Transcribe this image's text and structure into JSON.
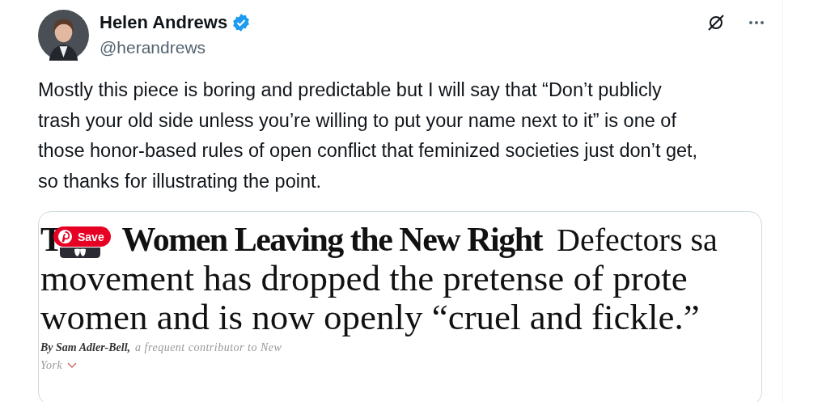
{
  "author": {
    "name": "Helen Andrews",
    "verified": true,
    "handle": "@herandrews"
  },
  "text": "Mostly this piece is boring and predictable but I will say that “Don’t publicly trash your old side unless you’re willing to put your name next to it” is one of those honor-based rules of open conflict that feminized societies just don’t get, so thanks for illustrating the point.",
  "card": {
    "headline_start": "T",
    "headline": "Women Leaving the New Right",
    "dek_lines": [
      "Defectors sa",
      "movement has dropped the pretense of prote",
      "women and is now openly “cruel and fickle.”"
    ],
    "byline_author": "By Sam Adler-Bell,",
    "byline_rest": "a frequent contributor to New",
    "byline_rest_2": "York"
  },
  "save_button": {
    "label": "Save"
  }
}
